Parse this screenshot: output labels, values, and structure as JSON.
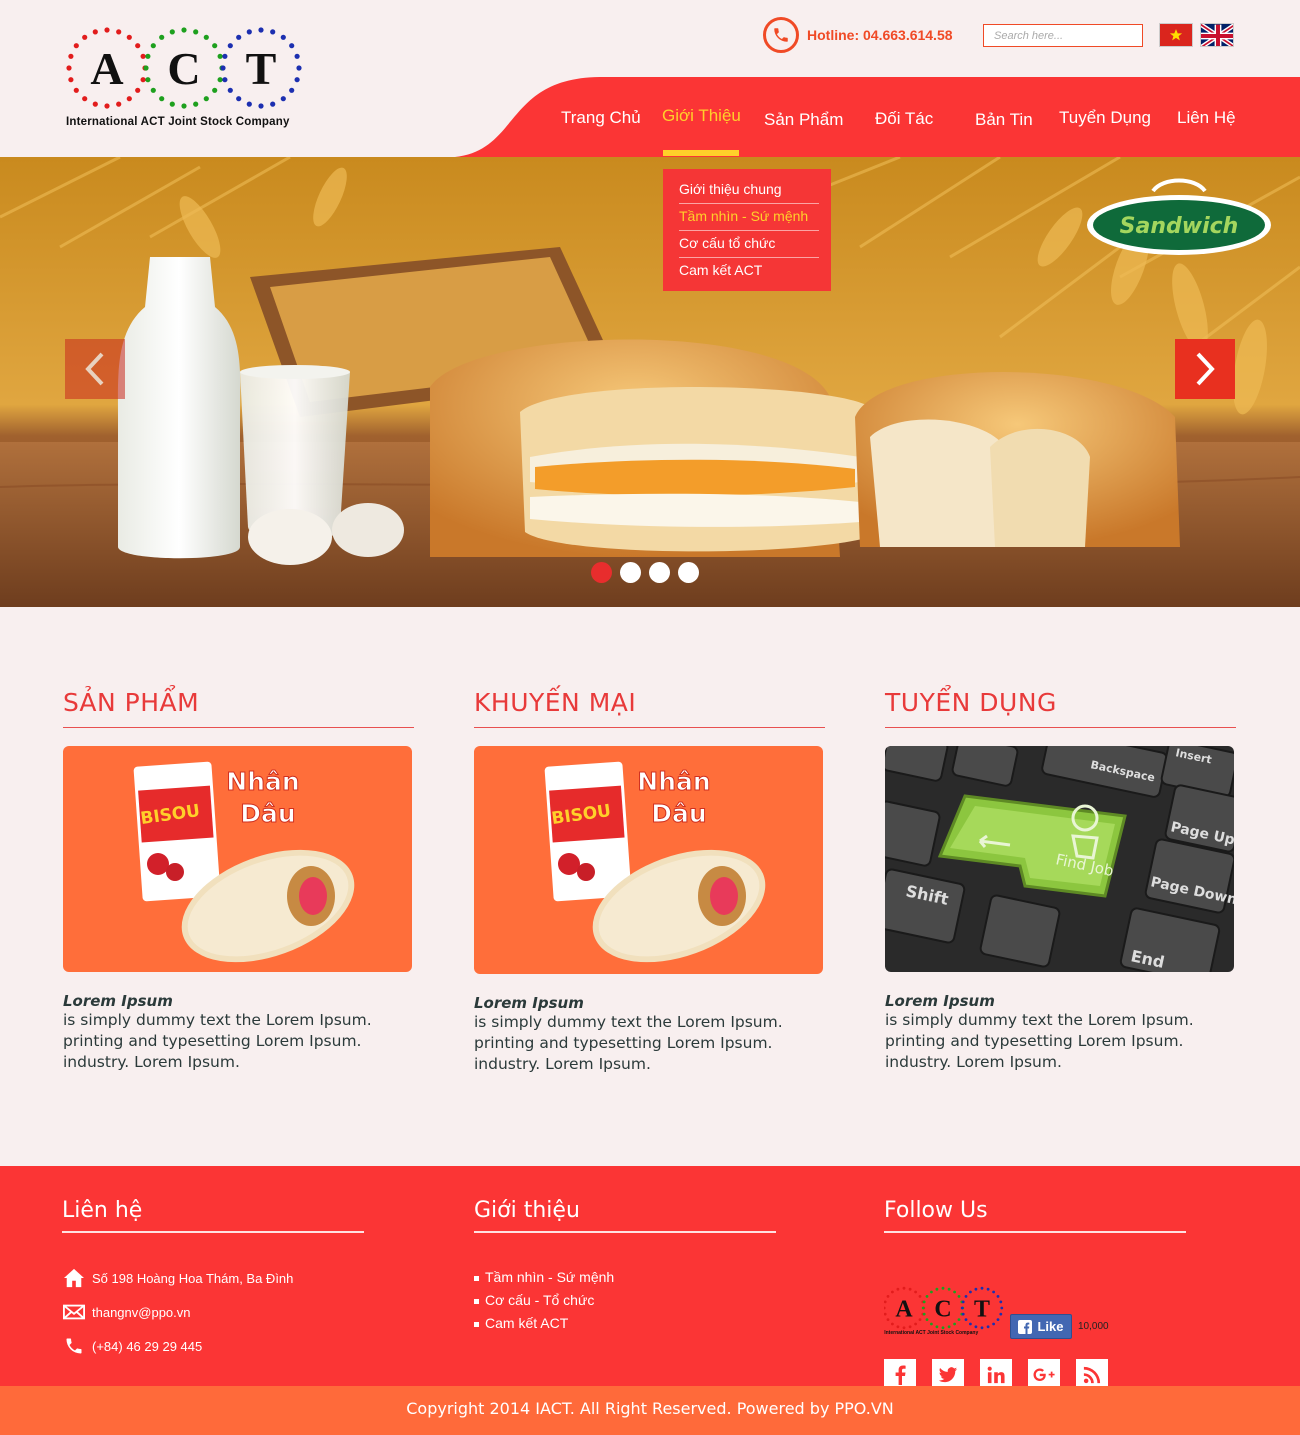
{
  "brand": {
    "letters": [
      "A",
      "C",
      "T"
    ],
    "company_name": "International ACT Joint Stock Company",
    "primary_color": "#fb3535",
    "accent_color": "#ffd02a"
  },
  "header": {
    "hotline": "Hotline: 04.663.614.58",
    "search_placeholder": "Search here..."
  },
  "nav": {
    "items": [
      {
        "label": "Trang Chủ"
      },
      {
        "label": "Giới Thiệu",
        "active": true
      },
      {
        "label": "Sản Phẩm"
      },
      {
        "label": "Đối Tác"
      },
      {
        "label": "Bản Tin"
      },
      {
        "label": "Tuyển Dụng"
      },
      {
        "label": "Liên Hệ"
      }
    ],
    "dropdown": [
      {
        "label": "Giới thiệu chung"
      },
      {
        "label": "Tầm nhìn - Sứ mệnh",
        "active": true
      },
      {
        "label": "Cơ cấu tổ chức"
      },
      {
        "label": "Cam kết ACT"
      }
    ]
  },
  "hero": {
    "badge": "Sandwich",
    "slide_count": 4,
    "active_slide": 1
  },
  "columns": [
    {
      "title": "SẢN PHẨM",
      "image_text": [
        "Nhân",
        "Dâu"
      ],
      "caption_title": "Lorem Ipsum",
      "caption_lines": [
        "is simply dummy text the Lorem Ipsum.",
        "printing and typesetting Lorem Ipsum.",
        "industry. Lorem Ipsum."
      ]
    },
    {
      "title": "KHUYẾN MẠI",
      "image_text": [
        "Nhân",
        "Dâu"
      ],
      "caption_title": "Lorem Ipsum",
      "caption_lines": [
        "is simply dummy text the Lorem Ipsum.",
        "printing and typesetting Lorem Ipsum.",
        "industry. Lorem Ipsum."
      ]
    },
    {
      "title": "TUYỂN DỤNG",
      "image_text": [
        "Find Job",
        "Shift",
        "Page Up",
        "Page Down",
        "Backspace",
        "Insert",
        "End"
      ],
      "caption_title": "Lorem Ipsum",
      "caption_lines": [
        "is simply dummy text the Lorem Ipsum.",
        "printing and typesetting Lorem Ipsum.",
        "industry. Lorem Ipsum."
      ]
    }
  ],
  "product_brand": "BISOU",
  "footer": {
    "contact": {
      "title": "Liên hệ",
      "address": "Số 198 Hoàng Hoa Thám, Ba Đình",
      "email": "thangnv@ppo.vn",
      "phone": "(+84) 46 29 29 445"
    },
    "about": {
      "title": "Giới thiệu",
      "links": [
        "Tầm nhìn - Sứ mệnh",
        "Cơ cấu - Tổ chức",
        "Cam kết ACT"
      ]
    },
    "follow": {
      "title": "Follow Us",
      "like_label": "Like",
      "like_count": "10,000",
      "socials": [
        "facebook-icon",
        "twitter-icon",
        "linkedin-icon",
        "google-plus-icon",
        "rss-icon"
      ]
    },
    "copyright": "Copyright 2014 IACT. All Right Reserved. Powered by PPO.VN"
  }
}
